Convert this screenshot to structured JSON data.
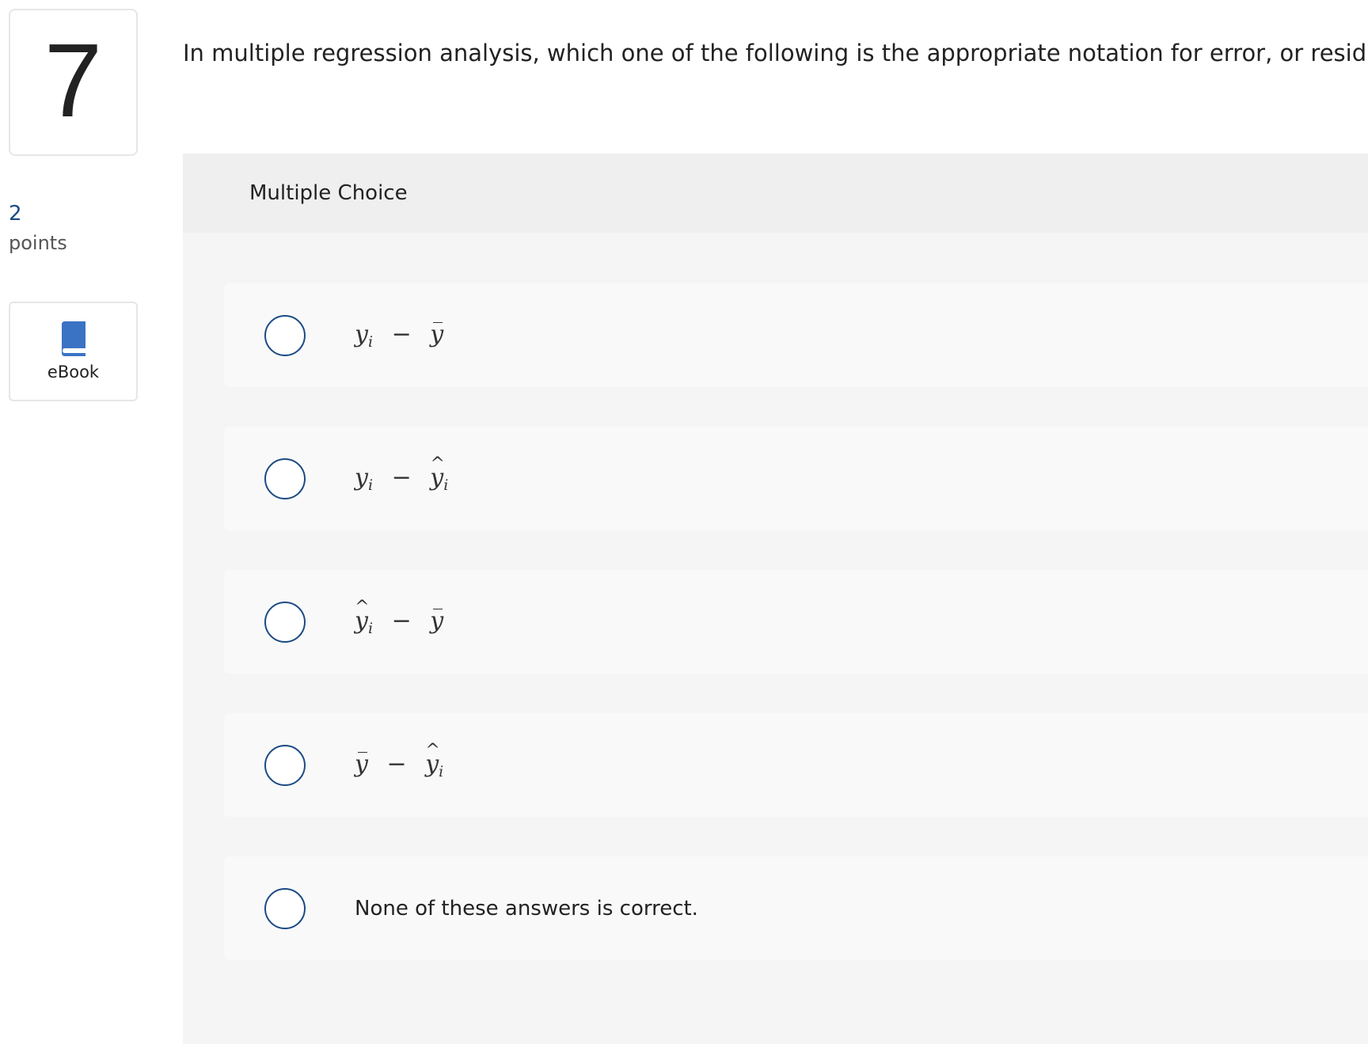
{
  "question": {
    "number": "7",
    "points_value": "2",
    "points_label": "points",
    "ebook_label": "eBook",
    "prompt": "In multiple regression analysis, which one of the following is the appropriate notation for error, or residual?"
  },
  "answer_panel": {
    "header": "Multiple Choice",
    "options": [
      {
        "a": "y",
        "a_sub": "i",
        "a_accent": "",
        "op": "−",
        "b": "y",
        "b_sub": "",
        "b_accent": "bar"
      },
      {
        "a": "y",
        "a_sub": "i",
        "a_accent": "",
        "op": "−",
        "b": "y",
        "b_sub": "i",
        "b_accent": "hat"
      },
      {
        "a": "y",
        "a_sub": "i",
        "a_accent": "hat",
        "op": "−",
        "b": "y",
        "b_sub": "",
        "b_accent": "bar"
      },
      {
        "a": "y",
        "a_sub": "",
        "a_accent": "bar",
        "op": "−",
        "b": "y",
        "b_sub": "i",
        "b_accent": "hat"
      },
      {
        "text": "None of these answers is correct."
      }
    ]
  },
  "colors": {
    "accent": "#1b4a84",
    "panel_bg": "#f5f5f5",
    "option_bg": "#f9f9f9"
  },
  "icons": {
    "ebook": "book-icon"
  }
}
